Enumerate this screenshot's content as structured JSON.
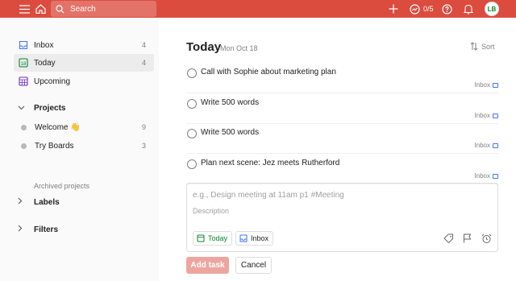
{
  "topbar": {
    "search_placeholder": "Search",
    "karma": "0/5",
    "avatar_initials": "LB",
    "bg_color": "#db4c3f"
  },
  "sidebar": {
    "items": [
      {
        "label": "Inbox",
        "count": "4",
        "icon": "inbox-icon"
      },
      {
        "label": "Today",
        "count": "4",
        "icon": "calendar-today-icon"
      },
      {
        "label": "Upcoming",
        "count": "",
        "icon": "calendar-grid-icon"
      }
    ],
    "projects_label": "Projects",
    "projects": [
      {
        "label": "Welcome 👋",
        "count": "9"
      },
      {
        "label": "Try Boards",
        "count": "3"
      }
    ],
    "archived_label": "Archived projects",
    "labels_label": "Labels",
    "filters_label": "Filters"
  },
  "main": {
    "title": "Today",
    "date": "Mon Oct 18",
    "sort_label": "Sort",
    "tasks": [
      {
        "text": "Call with Sophie about marketing plan",
        "project": "Inbox"
      },
      {
        "text": "Write 500 words",
        "project": "Inbox"
      },
      {
        "text": "Write 500 words",
        "project": "Inbox"
      },
      {
        "text": "Plan next scene: Jez meets Rutherford",
        "project": "Inbox"
      }
    ],
    "editor": {
      "task_placeholder": "e.g., Design meeting at 11am p1 #Meeting",
      "description_placeholder": "Description",
      "date_chip": "Today",
      "project_chip": "Inbox"
    },
    "add_task_label": "Add task",
    "cancel_label": "Cancel"
  },
  "colors": {
    "accent": "#db4c3f",
    "today_green": "#058527",
    "inbox_blue": "#4073ff",
    "upcoming_purple": "#692fc2"
  }
}
